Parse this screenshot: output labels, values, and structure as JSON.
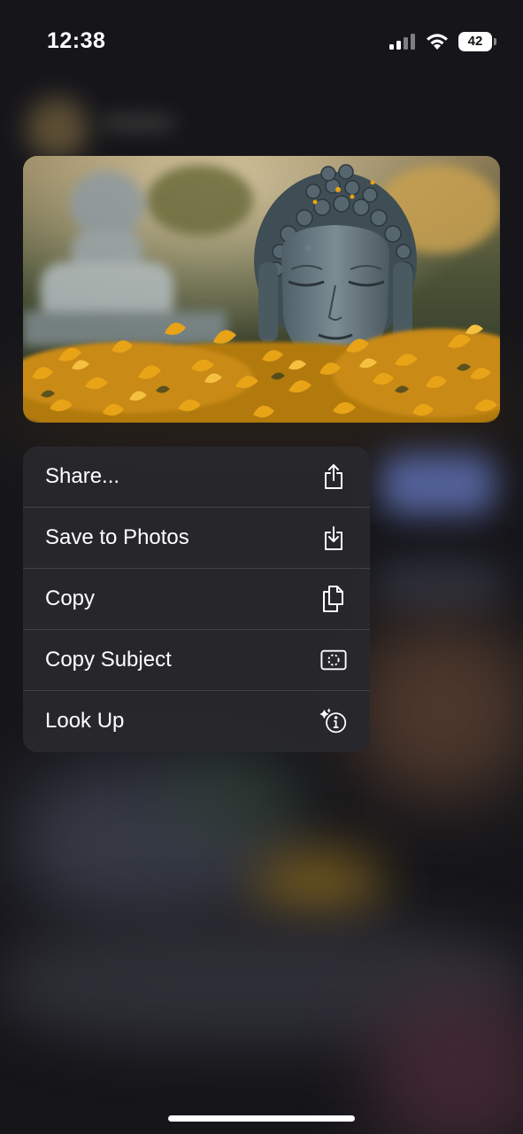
{
  "status_bar": {
    "time": "12:38",
    "battery_level": "42"
  },
  "preview": {
    "description_icon": "image-preview"
  },
  "menu": {
    "items": [
      {
        "label": "Share...",
        "icon": "share-icon"
      },
      {
        "label": "Save to Photos",
        "icon": "save-to-photos-icon"
      },
      {
        "label": "Copy",
        "icon": "copy-icon"
      },
      {
        "label": "Copy Subject",
        "icon": "copy-subject-icon"
      },
      {
        "label": "Look Up",
        "icon": "look-up-icon"
      }
    ]
  },
  "colors": {
    "background": "#16161a",
    "menu_background": "#28282c",
    "foliage": "#e8a317",
    "statue": "#6b7d86"
  }
}
